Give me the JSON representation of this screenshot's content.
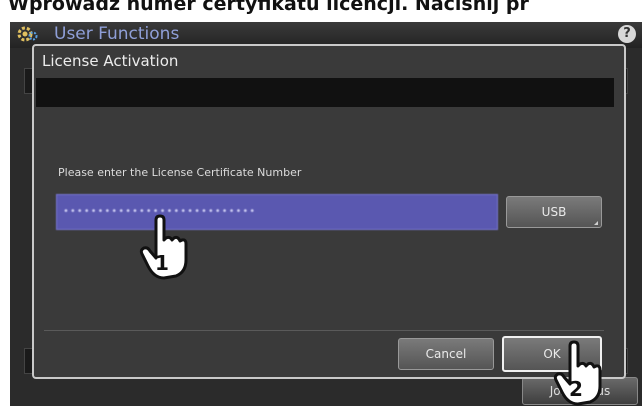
{
  "caption": "Wprowadź numer certyfikatu licencji. Naciśnij pr",
  "screen": {
    "title": "User Functions",
    "help_label": "?",
    "background_button": "Job Status"
  },
  "dialog": {
    "title": "License Activation",
    "prompt": "Please enter the License Certificate Number",
    "input_value": "••••••••••••••••••••••••••••",
    "usb_label": "USB",
    "cancel_label": "Cancel",
    "ok_label": "OK"
  },
  "callouts": [
    {
      "step": "1"
    },
    {
      "step": "2"
    }
  ],
  "colors": {
    "accent_input": "#5a58b0",
    "title_blue": "#8f9fd8",
    "background": "#2b2b2b"
  },
  "icons": [
    "gear-icon",
    "help-icon",
    "hand-pointer-icon"
  ]
}
